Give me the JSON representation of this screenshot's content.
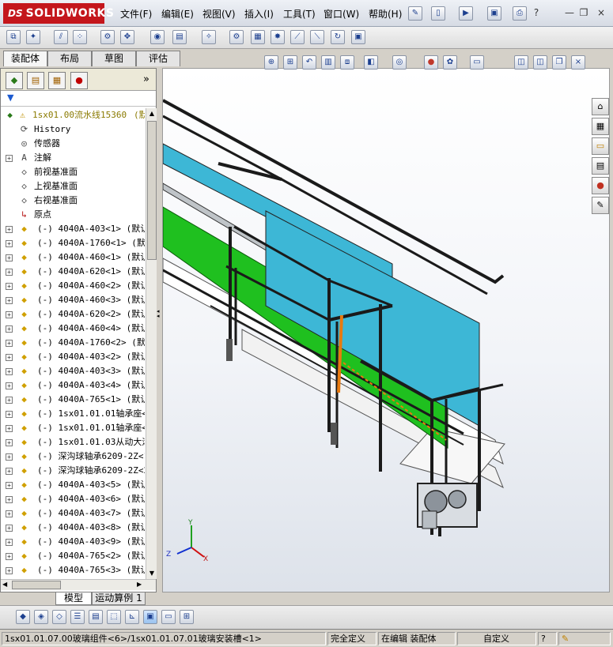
{
  "app": {
    "logo_ds": "DS",
    "logo_brand": "SOLIDWORKS"
  },
  "menu": [
    "文件(F)",
    "编辑(E)",
    "视图(V)",
    "插入(I)",
    "工具(T)",
    "窗口(W)",
    "帮助(H)"
  ],
  "window_controls": {
    "help": "?",
    "minimize": "—",
    "restore": "❐",
    "close": "×"
  },
  "command_tabs": [
    {
      "label": "装配体",
      "active": true
    },
    {
      "label": "布局",
      "active": false
    },
    {
      "label": "草图",
      "active": false
    },
    {
      "label": "评估",
      "active": false
    }
  ],
  "feature_manager": {
    "expand_glyph": "»",
    "filter_glyph": "▼",
    "root": {
      "label": "1sx01.00流水线15360",
      "suffix": "(默"
    },
    "features": [
      {
        "label": "History",
        "icon": "history-icon",
        "glyph": "⟳"
      },
      {
        "label": "传感器",
        "icon": "sensor-icon",
        "glyph": "◎"
      },
      {
        "label": "注解",
        "icon": "annotation-icon",
        "glyph": "A"
      },
      {
        "label": "前视基准面",
        "icon": "plane-icon",
        "glyph": "◇"
      },
      {
        "label": "上视基准面",
        "icon": "plane-icon",
        "glyph": "◇"
      },
      {
        "label": "右视基准面",
        "icon": "plane-icon",
        "glyph": "◇"
      },
      {
        "label": "原点",
        "icon": "origin-icon",
        "glyph": "↳"
      }
    ],
    "components": [
      "(-) 4040A-403<1> (默认<",
      "(-) 4040A-1760<1> (默认",
      "(-) 4040A-460<1> (默认<",
      "(-) 4040A-620<1> (默认<",
      "(-) 4040A-460<2> (默认<",
      "(-) 4040A-460<3> (默认<",
      "(-) 4040A-620<2> (默认<",
      "(-) 4040A-460<4> (默认<",
      "(-) 4040A-1760<2> (默认",
      "(-) 4040A-403<2> (默认<",
      "(-) 4040A-403<3> (默认<",
      "(-) 4040A-403<4> (默认<",
      "(-) 4040A-765<1> (默认<",
      "(-) 1sx01.01.01轴承座<1",
      "(-) 1sx01.01.01轴承座<2",
      "(-) 1sx01.01.03从动大滚",
      "(-) 深沟球轴承6209-2Z<1",
      "(-) 深沟球轴承6209-2Z<2",
      "(-) 4040A-403<5> (默认<",
      "(-) 4040A-403<6> (默认<",
      "(-) 4040A-403<7> (默认<",
      "(-) 4040A-403<8> (默认<",
      "(-) 4040A-403<9> (默认<",
      "(-) 4040A-765<2> (默认<",
      "(-) 4040A-765<3> (默认<"
    ]
  },
  "model_tabs": [
    {
      "label": "模型",
      "active": true
    },
    {
      "label": "运动算例 1",
      "active": false
    }
  ],
  "triad": {
    "x": "X",
    "y": "Y",
    "z": "Z"
  },
  "status": {
    "path": "1sx01.01.07.00玻璃组件<6>/1sx01.01.07.01玻璃安装槽<1>",
    "definition": "完全定义",
    "mode": "在编辑 装配体",
    "units": "自定义",
    "help_glyph": "?"
  },
  "colors": {
    "frame": "#1a1a1a",
    "glass": "#3db7d6",
    "belt": "#1fc01f",
    "accent": "#e87a10",
    "brand": "#c4161c"
  }
}
